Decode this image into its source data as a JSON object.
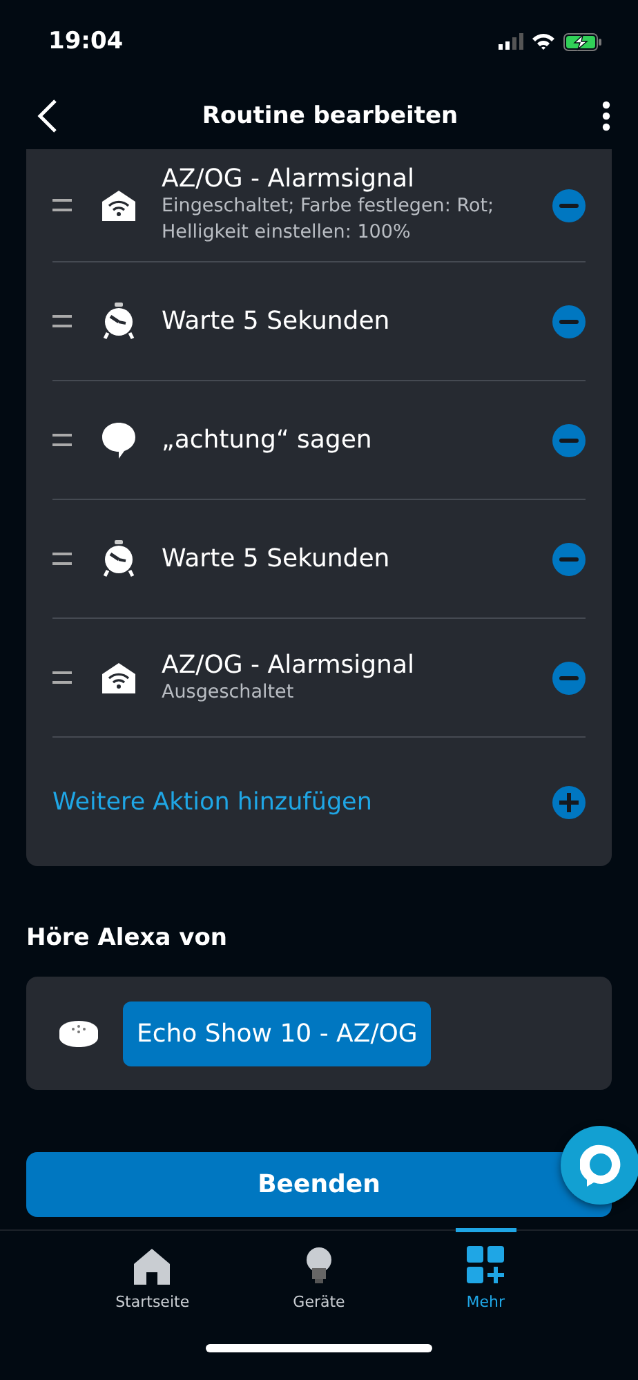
{
  "status_bar": {
    "time": "19:04"
  },
  "header": {
    "title": "Routine bearbeiten"
  },
  "actions": [
    {
      "kind": "device",
      "title": "AZ/OG - Alarmsignal",
      "detail": "Eingeschaltet; Farbe festlegen: Rot; Helligkeit einstellen: 100%"
    },
    {
      "kind": "wait",
      "title": "Warte 5 Sekunden"
    },
    {
      "kind": "speak",
      "title": "„achtung“ sagen"
    },
    {
      "kind": "wait",
      "title": "Warte 5 Sekunden"
    },
    {
      "kind": "device",
      "title": "AZ/OG - Alarmsignal",
      "detail": "Ausgeschaltet"
    }
  ],
  "add_action": {
    "label": "Weitere Aktion hinzufügen"
  },
  "speaker_section": {
    "heading": "Höre Alexa von",
    "device": "Echo Show 10 - AZ/OG"
  },
  "finish_button": {
    "label": "Beenden"
  },
  "tabs": [
    {
      "kind": "home",
      "label": "Startseite",
      "selected": false
    },
    {
      "kind": "devices",
      "label": "Geräte",
      "selected": false
    },
    {
      "kind": "more",
      "label": "Mehr",
      "selected": true
    }
  ]
}
